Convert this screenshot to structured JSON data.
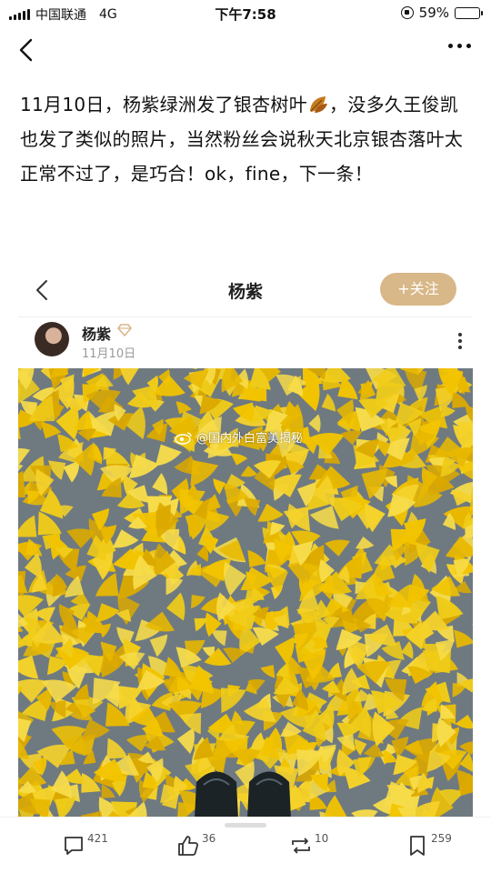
{
  "status_bar": {
    "carrier": "中国联通",
    "network": "4G",
    "time": "下午7:58",
    "battery": "59%",
    "battery_level": 0.59
  },
  "post": {
    "text": "11月10日，杨紫绿洲发了银杏树叶",
    "text_after_emoji": "，没多久王俊凯也发了类似的照片，当然粉丝会说秋天北京银杏落叶太正常不过了，是巧合！ok，fine，下一条！"
  },
  "card": {
    "title": "杨紫",
    "follow_label": "+关注",
    "author_name": "杨紫",
    "author_date": "11月10日",
    "watermark": "@国内外白富美揭秘"
  },
  "actions": {
    "comments": "421",
    "likes": "36",
    "reposts": "10",
    "favorites": "259"
  },
  "colors": {
    "follow_button": "#d8b788",
    "leaf_yellow": "#f2c400",
    "ground_gray": "#6f7a80"
  }
}
